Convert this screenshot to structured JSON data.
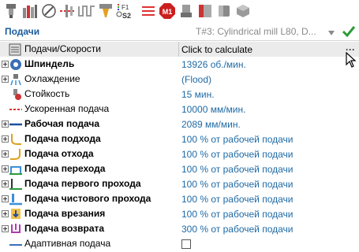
{
  "toolbar": {
    "icons": [
      "tool-holder-icon",
      "stock-bars-icon",
      "compass-icon",
      "feeds-icon",
      "wave-icon",
      "cutter-f1-s2-icon",
      "m1-stop-icon",
      "torch-icon",
      "red-block-icon",
      "cylinder-icon",
      "cube-icon"
    ],
    "f1_label": "F1",
    "s2_label": "S2",
    "m1_label": "M1"
  },
  "header": {
    "title": "Подачи",
    "tool": "T#3: Cylindrical mill L80, D..."
  },
  "grid": {
    "header_name": "Подачи/Скорости",
    "header_value": "Click to calculate",
    "more": "···",
    "rows": [
      {
        "name": "Шпиндель",
        "value": "13926 об./мин."
      },
      {
        "name": "Охлаждение",
        "value": "(Flood)"
      },
      {
        "name": "Стойкость",
        "value": "15 мин."
      },
      {
        "name": "Ускоренная подача",
        "value": "10000 мм/мин."
      },
      {
        "name": "Рабочая подача",
        "value": "2089 мм/мин."
      },
      {
        "name": "Подача подхода",
        "value": "100 % от рабочей подачи"
      },
      {
        "name": "Подача отхода",
        "value": "100 % от рабочей подачи"
      },
      {
        "name": "Подача перехода",
        "value": "100 % от рабочей подачи"
      },
      {
        "name": "Подача первого прохода",
        "value": "100 % от рабочей подачи"
      },
      {
        "name": "Подача чистового прохода",
        "value": "100 % от рабочей подачи"
      },
      {
        "name": "Подача врезания",
        "value": "100 % от рабочей подачи"
      },
      {
        "name": "Подача возврата",
        "value": "300 % от рабочей подачи"
      },
      {
        "name": "Адаптивная подача",
        "value": ""
      }
    ]
  },
  "colors": {
    "title": "#1b5c9c",
    "value": "#1f6aa5",
    "accent_check": "#2e9a3a"
  }
}
